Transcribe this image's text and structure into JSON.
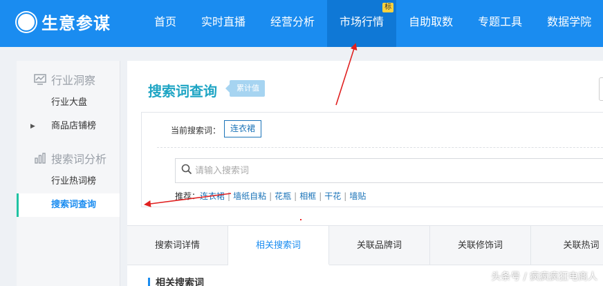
{
  "brand": {
    "name": "生意参谋"
  },
  "nav": {
    "items": [
      {
        "label": "首页"
      },
      {
        "label": "实时直播"
      },
      {
        "label": "经营分析"
      },
      {
        "label": "市场行情",
        "badge": "标",
        "active": true
      },
      {
        "label": "自助取数"
      },
      {
        "label": "专题工具"
      },
      {
        "label": "数据学院"
      }
    ]
  },
  "sidebar": {
    "groups": [
      {
        "title": "行业洞察",
        "icon": "chart-monitor-icon",
        "items": [
          {
            "label": "行业大盘"
          },
          {
            "label": "商品店铺榜",
            "expandable": true
          }
        ]
      },
      {
        "title": "搜索词分析",
        "icon": "bar-chart-icon",
        "items": [
          {
            "label": "行业热词榜"
          },
          {
            "label": "搜索词查询",
            "active": true
          }
        ]
      }
    ]
  },
  "main": {
    "title": "搜索词查询",
    "title_tag": "累计值",
    "current_label": "当前搜索词：",
    "current_word": "连衣裙",
    "search_placeholder": "请输入搜索词",
    "rec_label": "推荐：",
    "recommendations": [
      "连衣裙",
      "墙纸自粘",
      "花瓶",
      "相框",
      "干花",
      "墙贴"
    ],
    "tabs": [
      {
        "label": "搜索词详情"
      },
      {
        "label": "相关搜索词",
        "active": true
      },
      {
        "label": "关联品牌词"
      },
      {
        "label": "关联修饰词"
      },
      {
        "label": "关联热词"
      }
    ],
    "section_title": "相关搜索词"
  },
  "watermark": "头条号 / 疯疯疯狂电商人",
  "colors": {
    "nav_bg": "#1a8cf0",
    "accent": "#1a8cf0",
    "title": "#1fa5c4",
    "side_active_bar": "#1fc3a3",
    "annotation": "#e02020"
  }
}
